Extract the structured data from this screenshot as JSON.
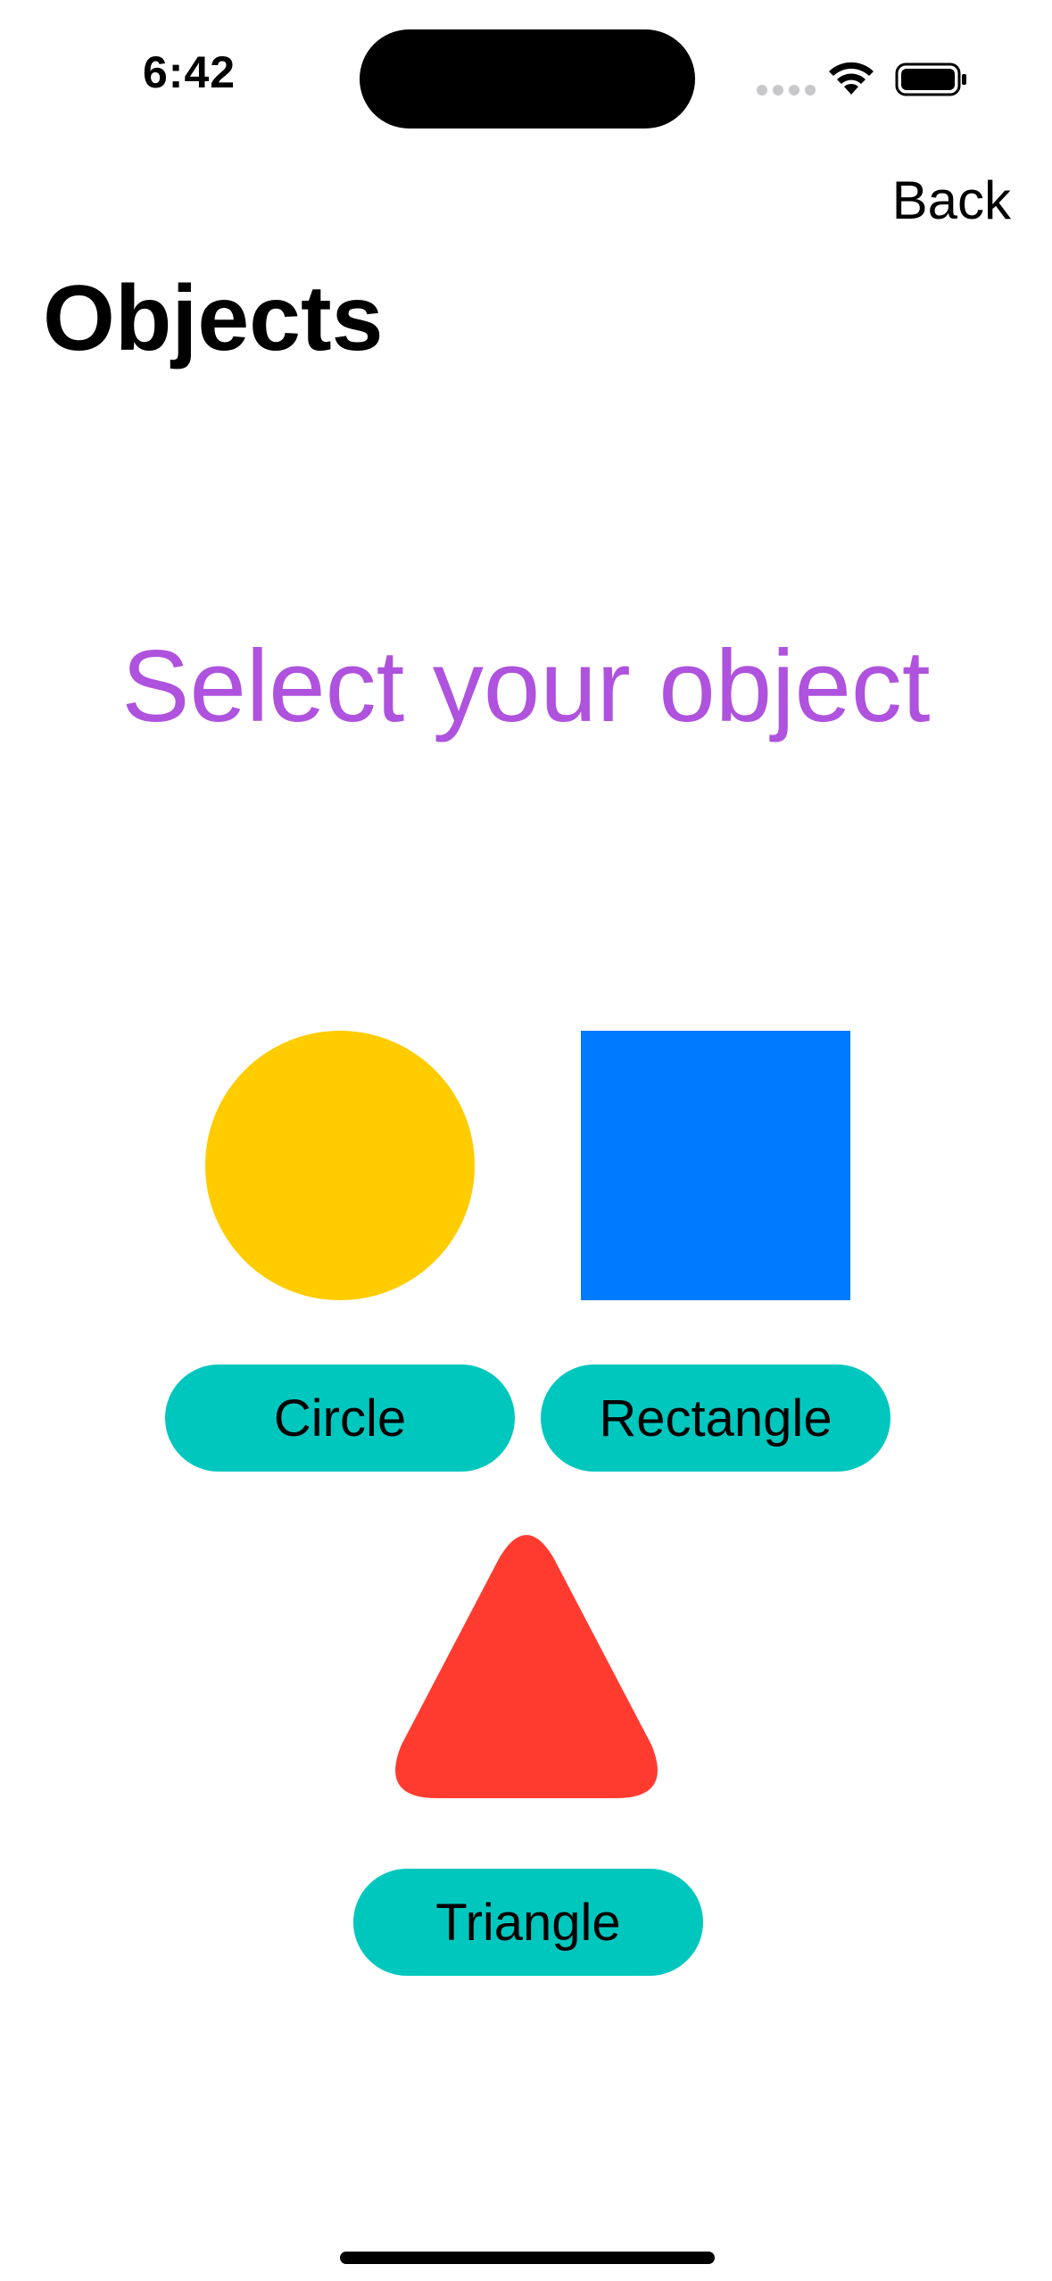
{
  "status_bar": {
    "time": "6:42",
    "wifi_icon": "wifi-icon",
    "battery_icon": "battery-icon"
  },
  "nav": {
    "back_label": "Back",
    "title": "Objects"
  },
  "main": {
    "headline": "Select your object",
    "headline_color": "#af52de",
    "objects": [
      {
        "label": "Circle",
        "shape": "circle",
        "color": "#ffcc00"
      },
      {
        "label": "Rectangle",
        "shape": "rectangle",
        "color": "#007aff"
      },
      {
        "label": "Triangle",
        "shape": "triangle",
        "color": "#ff3b30"
      }
    ],
    "button_color": "#00c7be"
  }
}
